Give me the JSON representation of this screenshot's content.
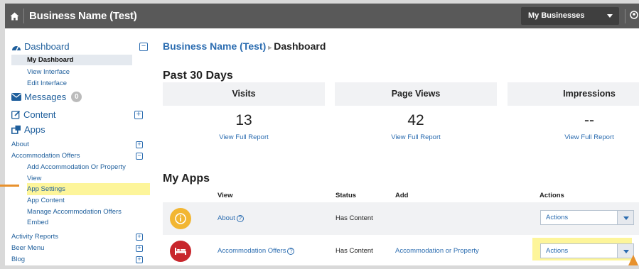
{
  "topbar": {
    "brand": "Business Name (Test)",
    "business_select": "My Businesses"
  },
  "sidebar": {
    "dashboard": "Dashboard",
    "my_dashboard": "My Dashboard",
    "view_interface": "View Interface",
    "edit_interface": "Edit Interface",
    "messages": "Messages",
    "messages_count": "0",
    "content": "Content",
    "apps": "Apps",
    "items": [
      {
        "label": "About"
      },
      {
        "label": "Accommodation Offers"
      }
    ],
    "accommodation_sub": [
      "Add Accommodation Or Property",
      "View",
      "App Settings",
      "App Content",
      "Manage Accommodation Offers",
      "Embed"
    ],
    "bottom_items": [
      {
        "label": "Activity Reports"
      },
      {
        "label": "Beer Menu"
      },
      {
        "label": "Blog"
      }
    ]
  },
  "main": {
    "breadcrumb_link": "Business Name (Test)",
    "breadcrumb_current": "Dashboard",
    "period_heading": "Past 30 Days",
    "stats": [
      {
        "label": "Visits",
        "value": "13",
        "link": "View Full Report"
      },
      {
        "label": "Page Views",
        "value": "42",
        "link": "View Full Report"
      },
      {
        "label": "Impressions",
        "value": "--",
        "link": "View Full Report"
      }
    ],
    "apps_heading": "My Apps",
    "columns": {
      "view": "View",
      "status": "Status",
      "add": "Add",
      "actions": "Actions"
    },
    "apps": [
      {
        "name": "About",
        "status": "Has Content",
        "add": "",
        "action": "Actions",
        "icon_color": "#f2b632"
      },
      {
        "name": "Accommodation Offers",
        "status": "Has Content",
        "add": "Accommodation or Property",
        "action": "Actions",
        "icon_color": "#c8262c"
      }
    ]
  },
  "colors": {
    "topbar": "#595959",
    "link": "#2b6cb0",
    "highlight": "#fdf59a",
    "callout": "#e8912d"
  }
}
